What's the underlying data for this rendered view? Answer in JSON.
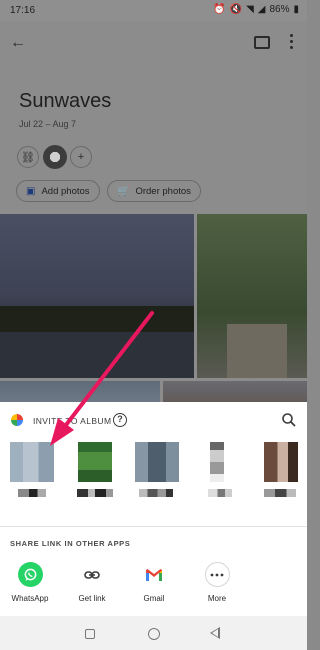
{
  "status_bar": {
    "time": "17:16",
    "battery": "86%"
  },
  "album": {
    "title": "Sunwaves",
    "dates": "Jul 22 – Aug 7",
    "add_photos_label": "Add photos",
    "order_photos_label": "Order photos"
  },
  "share_sheet": {
    "invite_label": "INVITE TO ALBUM",
    "section_title": "SHARE LINK IN OTHER APPS",
    "apps": [
      {
        "label": "WhatsApp",
        "icon": "whatsapp-icon",
        "color": "#25D366"
      },
      {
        "label": "Get link",
        "icon": "link-icon",
        "color": "#ffffff"
      },
      {
        "label": "Gmail",
        "icon": "gmail-icon",
        "color": "#ffffff"
      },
      {
        "label": "More",
        "icon": "more-icon",
        "color": "#f1f1f1"
      }
    ]
  },
  "colors": {
    "accent": "#1a73e8",
    "annotation_arrow": "#e8185e"
  }
}
